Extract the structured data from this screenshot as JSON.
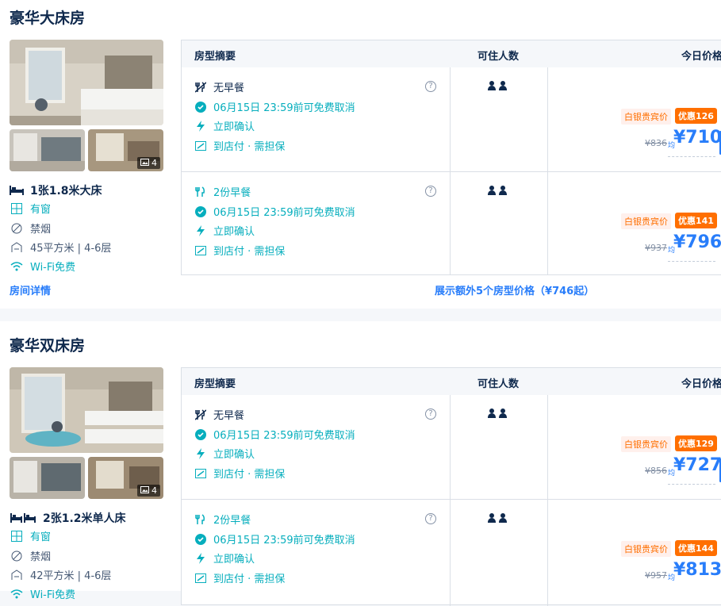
{
  "rooms": [
    {
      "name": "豪华大床房",
      "photo_count": "4",
      "bed": "1张1.8米大床",
      "window": "有窗",
      "smoking": "禁烟",
      "size_floor": "45平方米 | 4-6层",
      "wifi": "Wi-Fi免费",
      "details_link": "房间详情",
      "more_link": "展示额外5个房型价格（¥746起）",
      "rates": [
        {
          "meal": "无早餐",
          "cancel": "06月15日 23:59前可免费取消",
          "confirm": "立即确认",
          "payment": "到店付 · 需担保",
          "member_tag": "白银贵宾价",
          "discount": "优惠126",
          "old_price": "¥836",
          "avg": "均",
          "price": "¥710"
        },
        {
          "meal": "2份早餐",
          "cancel": "06月15日 23:59前可免费取消",
          "confirm": "立即确认",
          "payment": "到店付 · 需担保",
          "member_tag": "白银贵宾价",
          "discount": "优惠141",
          "old_price": "¥937",
          "avg": "均",
          "price": "¥796"
        }
      ]
    },
    {
      "name": "豪华双床房",
      "photo_count": "4",
      "bed": "2张1.2米单人床",
      "window": "有窗",
      "smoking": "禁烟",
      "size_floor": "42平方米 | 4-6层",
      "wifi": "Wi-Fi免费",
      "rates": [
        {
          "meal": "无早餐",
          "cancel": "06月15日 23:59前可免费取消",
          "confirm": "立即确认",
          "payment": "到店付 · 需担保",
          "member_tag": "白银贵宾价",
          "discount": "优惠129",
          "old_price": "¥856",
          "avg": "均",
          "price": "¥727"
        },
        {
          "meal": "2份早餐",
          "cancel": "06月15日 23:59前可免费取消",
          "confirm": "立即确认",
          "payment": "到店付 · 需担保",
          "member_tag": "白银贵宾价",
          "discount": "优惠144",
          "old_price": "¥957",
          "avg": "均",
          "price": "¥813"
        }
      ]
    }
  ],
  "table_headers": {
    "summary": "房型摘要",
    "guests": "可住人数",
    "price": "今日价格"
  },
  "colors": {
    "accent": "#287dfa",
    "green": "#06aebd",
    "orange": "#ff6f00",
    "text": "#0f294d"
  }
}
